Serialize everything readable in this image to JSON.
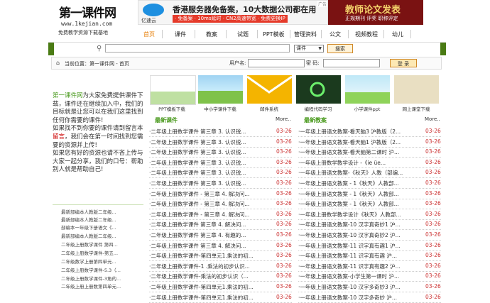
{
  "logo": {
    "title": "第一课件网",
    "url": "www.1kejian.com",
    "slogan": "免费教学资源下载基地"
  },
  "ads": {
    "ad1": {
      "brand": "亿速云",
      "line1": "香港服务器免备案，10大数据公司都在用",
      "line2": "· 免备案 · 10ms延时 · CN2高速带宽 · 免费更换IP",
      "ad_mark": "广告"
    },
    "ad2": {
      "line1": "教师论文发表",
      "line2": "正规期刊  评奖  职称评定"
    }
  },
  "nav": {
    "items": [
      "首页",
      "课件",
      "教案",
      "试题",
      "PPT模板",
      "管理资料",
      "公文",
      "视频教程",
      "幼儿"
    ]
  },
  "search": {
    "placeholder": "",
    "select_value": "课件",
    "button": "搜索"
  },
  "location": {
    "label": "当前位置：第一课件网 - 首页"
  },
  "login": {
    "user_label": "用户名:",
    "pass_label": "密 码:",
    "button": "登 录"
  },
  "intro_text": {
    "p1_hl": "第一课件网",
    "p1": "为大家免费提供课件下载，课件还在继续加入中，我们的目标就是让您可以在我们这里找到任何你需要的课件!",
    "p2a": "如果找不到你要的课件请到留言本",
    "p2b": "留言",
    "p2c": "，我们会在第一时间找到您需要的资源并上传!",
    "p3": "如果您有好的资源也请不吝上传与大家一起分享，我们的口号：帮助别人就是帮助自己!"
  },
  "left_list": [
    "最新部编本人教版二年级...",
    "最新部编本人教版二年级...",
    "部编本一年级下册语文《...",
    "最新部编本人教版二年级...",
    "二年级上册数学课件 第四...",
    "二年级上册数学课件-第五...",
    "二年级数学上册第四单元...",
    "二年级上册数学课件-5.3（...",
    "二年级上册数学课件-3角的...",
    "二年级上册上册数第四单元..."
  ],
  "thumbs": [
    "PPT模板下载",
    "中小学课件下载",
    "邮件系统",
    "编程代码学习",
    "小学课件ppt",
    "网上课堂下载"
  ],
  "col1": {
    "title": "最新课件",
    "more": "More..",
    "rows": [
      {
        "t": "·二年级上册数学课件 第三章 3. 认识锐...",
        "d": "03-26"
      },
      {
        "t": "·二年级上册数学课件 第三章 3. 认识锐...",
        "d": "03-26"
      },
      {
        "t": "·二年级上册数学课件 第三章 3. 认识锐...",
        "d": "03-26"
      },
      {
        "t": "·二年级上册数学课件 第三章 3. 认识锐...",
        "d": "03-26"
      },
      {
        "t": "·二年级上册数学课件 第三章 3. 认识锐...",
        "d": "03-26"
      },
      {
        "t": "·二年级上册数学课件 第三章 3. 认识锐...",
        "d": "03-26"
      },
      {
        "t": "·二年级上册数学课件 - 第三章 4. 解决问...",
        "d": "03-26"
      },
      {
        "t": "·二年级上册数学课件 - 第三章 4. 解决问...",
        "d": "03-26"
      },
      {
        "t": "·二年级上册数学课件 - 第三章 4. 解决问...",
        "d": "03-26"
      },
      {
        "t": "·二年级上册数学课件 第三章 4. 解决问...",
        "d": "03-26"
      },
      {
        "t": "·二年级上册数学课件 第三章 4. 有趣的...",
        "d": "03-26"
      },
      {
        "t": "·二年级上册数学课件 第三章 4. 解决问...",
        "d": "03-26"
      },
      {
        "t": "·二年级上册数学课件-第四单元1.乘法的初...",
        "d": "03-26"
      },
      {
        "t": "·二年级上册数学课件-1 .乘法的初步认识...",
        "d": "03-26"
      },
      {
        "t": "·二年级上册数学课件-乘法的初步认识（...",
        "d": "03-26"
      },
      {
        "t": "·二年级上册数学课件-第四单元1.乘法的初...",
        "d": "03-26"
      },
      {
        "t": "·二年级上册数学课件-第四单元1.乘法的初...",
        "d": "03-26"
      }
    ]
  },
  "col2": {
    "title": "最新教案",
    "more": "More..",
    "rows": [
      {
        "t": "·一年级上册语文教案-看天脑3 沪教版（2...",
        "d": "03-26"
      },
      {
        "t": "·一年级上册语文教案-看天脑1 沪教版（2...",
        "d": "03-26"
      },
      {
        "t": "·一年级上册语文教案-看天脑第二课时 沪...",
        "d": "03-26"
      },
      {
        "t": "·一年级上册数学教学设计 -《ie üe...",
        "d": "03-26"
      },
      {
        "t": "·一年级上册语文教案-《秋天》人教（部编...",
        "d": "03-26"
      },
      {
        "t": "·一年级上册语文教案 - 1《秋天》人教部...",
        "d": "03-26"
      },
      {
        "t": "·一年级上册语文教案 - 1《秋天》人教部...",
        "d": "03-26"
      },
      {
        "t": "·一年级上册语文教案 - 1《秋天》人教部...",
        "d": "03-26"
      },
      {
        "t": "·一年级上册数学教学设计《秋天》人教部...",
        "d": "03-26"
      },
      {
        "t": "·一年级上册语文教案-10 汉字真奇妙1 沪...",
        "d": "03-26"
      },
      {
        "t": "·一年级上册语文教案-10 汉字真奇妙2 沪...",
        "d": "03-26"
      },
      {
        "t": "·一年级上册语文教案-11 识字真有趣1 沪...",
        "d": "03-26"
      },
      {
        "t": "·一年级上册语文教案-11 识字真有趣 沪...",
        "d": "03-26"
      },
      {
        "t": "·一年级上册语文教案-11 识字真有趣2 沪...",
        "d": "03-26"
      },
      {
        "t": "·一年级上册语文教案-小学生第一课时 沪...",
        "d": "03-26"
      },
      {
        "t": "·一年级上册语文教案-10 汉字多奇妙3 沪...",
        "d": "03-26"
      },
      {
        "t": "·一年级上册语文教案-10 汉字多奇妙 沪...",
        "d": "03-26"
      }
    ]
  },
  "colors": {
    "green": "#4a9a1e",
    "date_red": "#cc3333",
    "nav_active": "#e77f08",
    "dark_green": "#4a7b14"
  }
}
